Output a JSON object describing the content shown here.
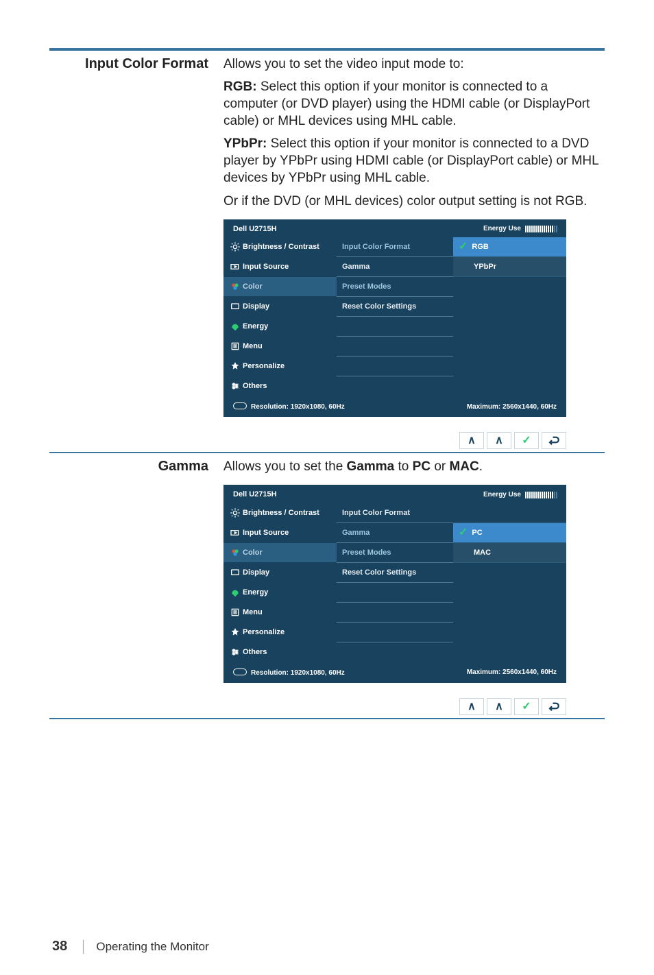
{
  "page": {
    "number": "38",
    "chapter": "Operating the Monitor"
  },
  "section1": {
    "title": "Input Color Format",
    "intro": "Allows you to set the video input mode to:",
    "rgb_label": "RGB:",
    "rgb_text": " Select this option if your monitor is connected to a computer (or DVD player) using the HDMI cable (or DisplayPort cable) or MHL devices using MHL cable.",
    "ypbpr_label": "YPbPr:",
    "ypbpr_text": " Select this option if your monitor is connected to a DVD player by YPbPr using HDMI cable (or DisplayPort cable) or MHL devices by YPbPr using MHL cable.",
    "extra": "Or if the DVD (or MHL devices) color output setting is not RGB."
  },
  "section2": {
    "title": "Gamma",
    "intro_pre": "Allows you to set the ",
    "intro_bold1": "Gamma",
    "intro_mid": " to ",
    "intro_bold2": "PC",
    "intro_or": " or ",
    "intro_bold3": "MAC",
    "intro_end": "."
  },
  "osd": {
    "title": "Dell U2715H",
    "energy": "Energy Use",
    "left": {
      "brightness": "Brightness / Contrast",
      "input": "Input Source",
      "color": "Color",
      "display": "Display",
      "energy": "Energy",
      "menu": "Menu",
      "personalize": "Personalize",
      "others": "Others"
    },
    "mid": {
      "icf": "Input Color Format",
      "gamma": "Gamma",
      "preset": "Preset Modes",
      "reset": "Reset Color Settings"
    },
    "right1": {
      "rgb": "RGB",
      "ypbpr": "YPbPr"
    },
    "right2": {
      "pc": "PC",
      "mac": "MAC"
    },
    "footer": {
      "res": "Resolution: 1920x1080, 60Hz",
      "max": "Maximum: 2560x1440, 60Hz"
    }
  }
}
